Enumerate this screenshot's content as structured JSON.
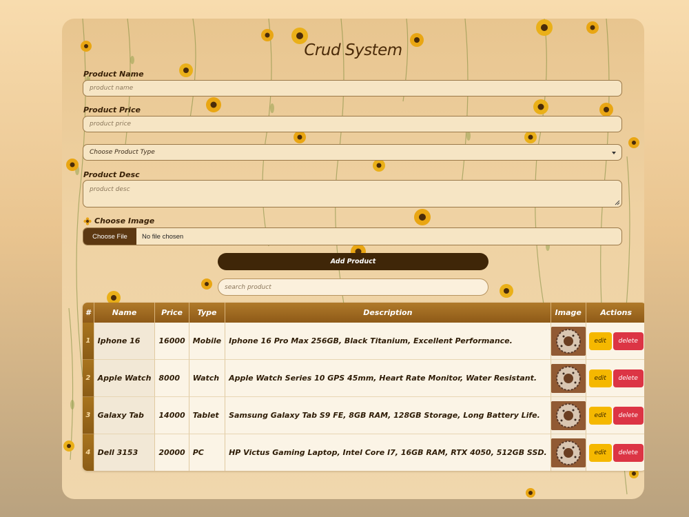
{
  "app": {
    "title": "Crud System"
  },
  "form": {
    "name_label": "Product Name",
    "name_placeholder": "product name",
    "price_label": "Product Price",
    "price_placeholder": "product price",
    "type_select_value": "Choose Product Type",
    "desc_label": "Product Desc",
    "desc_placeholder": "product desc",
    "image_label": "Choose Image",
    "image_icon": "flower-icon",
    "file_button": "Choose File",
    "file_status": "No file chosen",
    "add_button": "Add Product"
  },
  "search": {
    "placeholder": "search product"
  },
  "table": {
    "headers": [
      "#",
      "Name",
      "Price",
      "Type",
      "Description",
      "Image",
      "Actions"
    ],
    "edit_label": "edit",
    "delete_label": "delete",
    "rows": [
      {
        "index": "1",
        "name": "Iphone 16",
        "price": "16000",
        "type": "Mobile",
        "description": "Iphone 16 Pro Max 256GB, Black Titanium, Excellent Performance."
      },
      {
        "index": "2",
        "name": "Apple Watch",
        "price": "8000",
        "type": "Watch",
        "description": "Apple Watch Series 10 GPS 45mm, Heart Rate Monitor, Water Resistant."
      },
      {
        "index": "3",
        "name": "Galaxy Tab",
        "price": "14000",
        "type": "Tablet",
        "description": "Samsung Galaxy Tab S9 FE, 8GB RAM, 128GB Storage, Long Battery Life."
      },
      {
        "index": "4",
        "name": "Dell 3153",
        "price": "20000",
        "type": "PC",
        "description": "HP Victus Gaming Laptop, Intel Core I7, 16GB RAM, RTX 4050, 512GB SSD."
      }
    ]
  },
  "colors": {
    "accent_dark": "#3f2608",
    "header_brown": "#9a6520",
    "edit": "#f5b800",
    "delete": "#dc3545"
  }
}
